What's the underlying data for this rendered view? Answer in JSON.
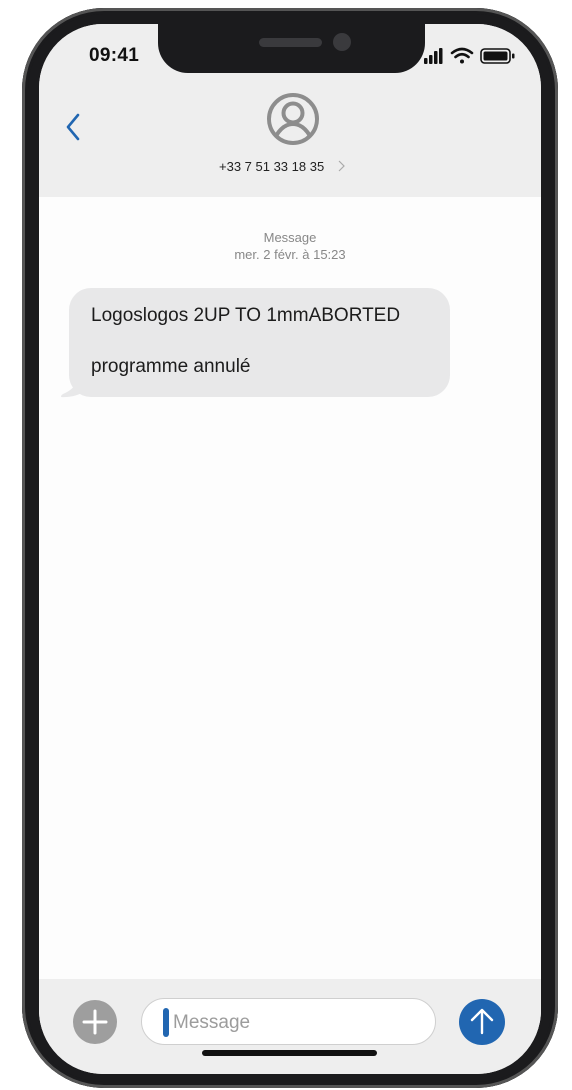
{
  "status_bar": {
    "time": "09:41",
    "icons": [
      "signal-icon",
      "wifi-icon",
      "battery-icon"
    ]
  },
  "header": {
    "back_icon": "chevron-left-icon",
    "avatar_icon": "person-icon",
    "contact_number": "+33 7 51 33 18 35",
    "contact_chevron_icon": "chevron-right-icon"
  },
  "conversation": {
    "service_label": "Message",
    "timestamp": "mer. 2 févr. à 15:23",
    "messages": [
      {
        "direction": "incoming",
        "lines": [
          "Logoslogos 2UP TO 1mmABORTED",
          "programme annulé"
        ]
      }
    ]
  },
  "composer": {
    "add_icon": "plus-icon",
    "placeholder": "Message",
    "send_icon": "arrow-up-icon"
  },
  "colors": {
    "accent": "#2166b1",
    "header_bg": "#eeeeee",
    "bubble_bg": "#e8e8e9",
    "frame": "#1b1b1d"
  }
}
